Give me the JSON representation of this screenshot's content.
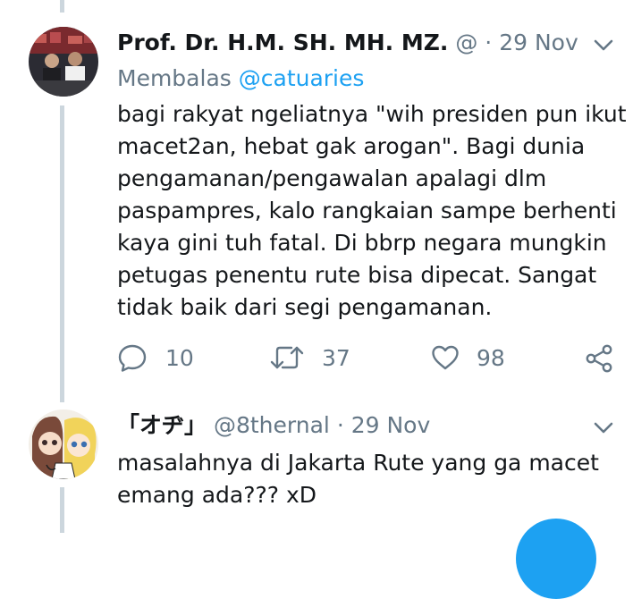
{
  "tweet1": {
    "display_name": "Prof. Dr. H.M. SH. MH. MZ.",
    "handle": "@",
    "separator": "·",
    "date": "29 Nov",
    "reply_prefix": "Membalas",
    "reply_handle": "@catuaries",
    "text_lines": [
      "bagi rakyat ngeliatnya \"wih presiden pun ikut",
      "macet2an, hebat gak arogan\". Bagi dunia",
      "pengamanan/pengawalan apalagi dlm",
      "paspampres, kalo rangkaian sampe berhenti",
      "kaya gini tuh fatal. Di bbrp negara mungkin",
      "petugas penentu rute bisa dipecat. Sangat",
      "tidak baik dari segi pengamanan."
    ],
    "replies": "10",
    "retweets": "37",
    "likes": "98"
  },
  "tweet2": {
    "display_name": "「オヂ」",
    "handle": "@8thernal",
    "separator": "·",
    "date": "29 Nov",
    "text_lines": [
      "masalahnya di Jakarta Rute yang ga macet",
      "emang ada??? xD"
    ]
  },
  "colors": {
    "muted": "#657786",
    "link": "#1da1f2",
    "thread_line": "#ccd6dd",
    "text": "#14171a"
  }
}
